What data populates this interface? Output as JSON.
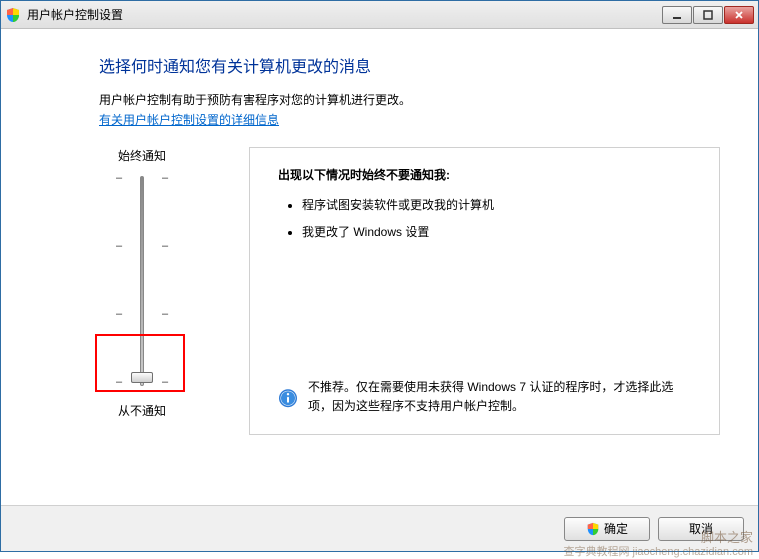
{
  "window": {
    "title": "用户帐户控制设置"
  },
  "content": {
    "heading": "选择何时通知您有关计算机更改的消息",
    "description": "用户帐户控制有助于预防有害程序对您的计算机进行更改。",
    "learn_more_link": "有关用户帐户控制设置的详细信息"
  },
  "slider": {
    "top_label": "始终通知",
    "bottom_label": "从不通知"
  },
  "panel": {
    "heading": "出现以下情况时始终不要通知我:",
    "items": [
      "程序试图安装软件或更改我的计算机",
      "我更改了 Windows 设置"
    ],
    "recommendation": "不推荐。仅在需要使用未获得 Windows 7 认证的程序时，才选择此选项，因为这些程序不支持用户帐户控制。"
  },
  "buttons": {
    "ok": "确定",
    "cancel": "取消"
  },
  "watermark": {
    "line1": "脚本之家",
    "line2": "查字典教程网 jiaocheng.chazidian.com"
  }
}
